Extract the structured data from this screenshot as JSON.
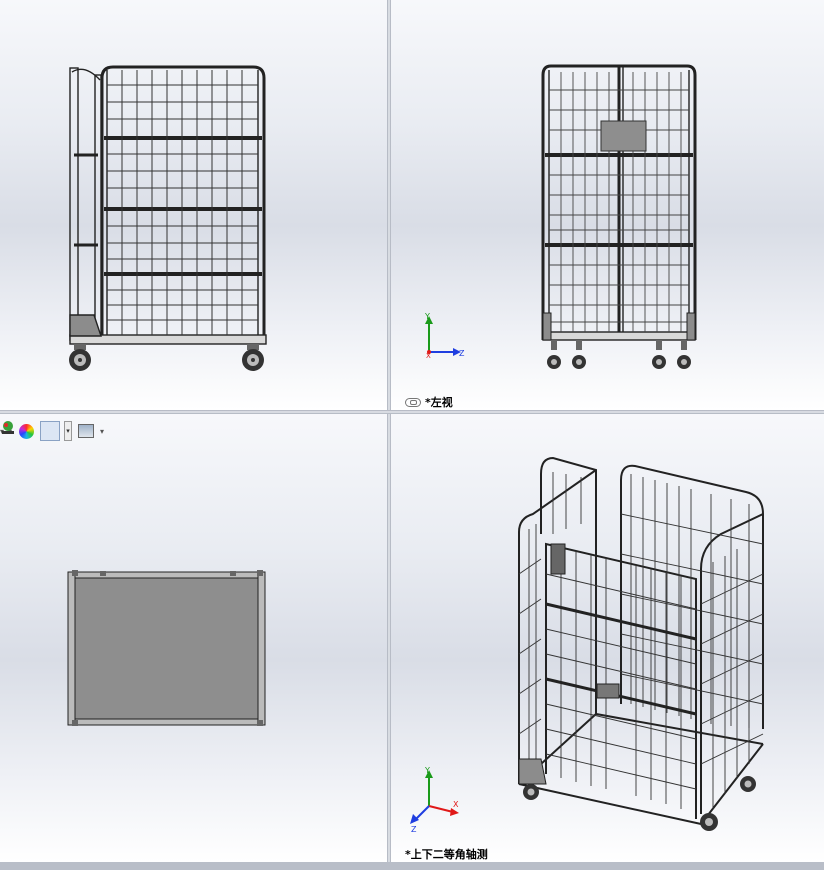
{
  "viewports": {
    "top_left": {
      "label": ""
    },
    "top_right": {
      "label": "*左视"
    },
    "bottom_left": {
      "label": ""
    },
    "bottom_right": {
      "label": "*上下二等角轴测"
    }
  },
  "triad": {
    "axis_y": "Y",
    "axis_z": "Z",
    "axis_x": "X"
  },
  "toolbar": {
    "items": [
      "view-settings",
      "appearance",
      "scene",
      "display-pane"
    ]
  },
  "icons": [
    "link-icon",
    "color-wheel-icon",
    "apply-scene-icon",
    "display-options-icon"
  ],
  "colors": {
    "triad_y": "#1a9a1a",
    "triad_z": "#1f3ee0",
    "triad_x": "#e01818",
    "part_gray": "#8e8e8e"
  }
}
